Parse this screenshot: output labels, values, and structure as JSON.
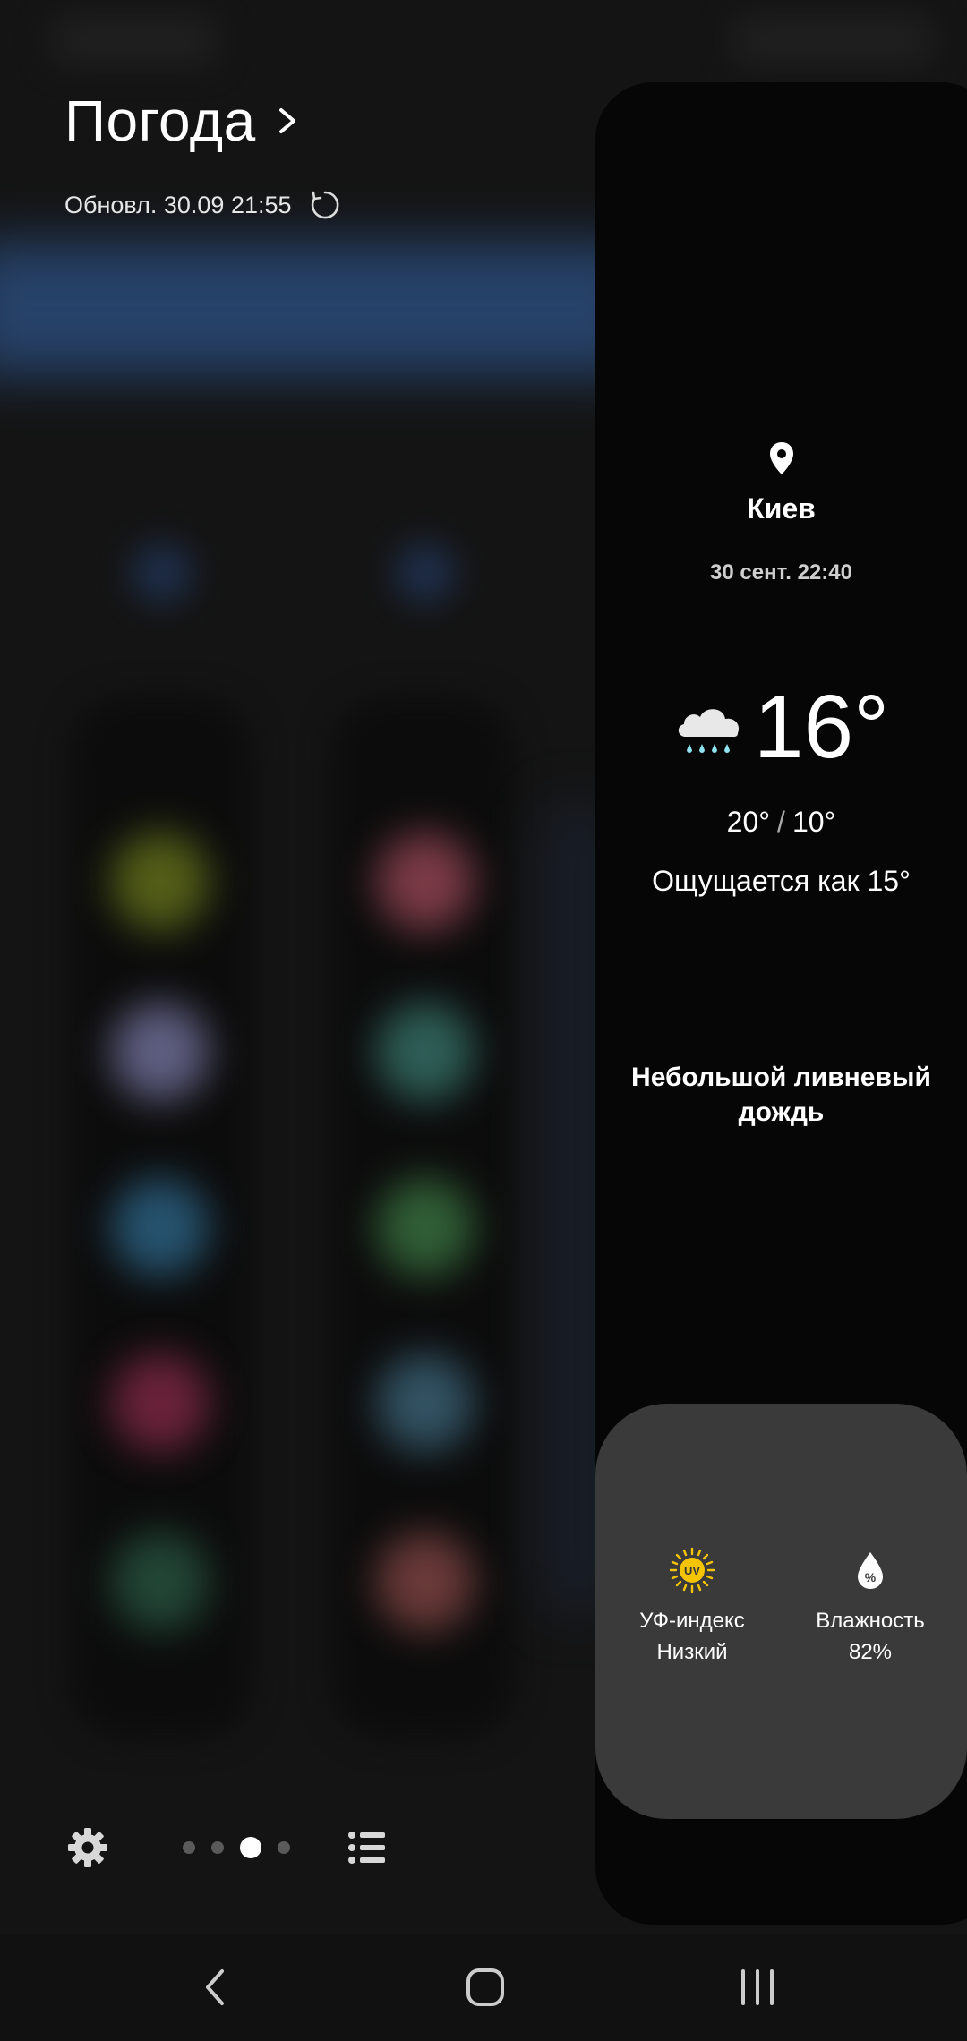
{
  "header": {
    "title": "Погода",
    "updated": "Обновл. 30.09 21:55"
  },
  "weather": {
    "city": "Киев",
    "datetime": "30 сент. 22:40",
    "temperature": "16°",
    "high": "20°",
    "separator": "/",
    "low": "10°",
    "feels_like": "Ощущается как 15°",
    "condition": "Небольшой ливневый дождь",
    "condition_icon": "rain-cloud-icon"
  },
  "details": {
    "uv": {
      "label": "УФ-индекс",
      "value": "Низкий",
      "icon": "uv-index-icon",
      "icon_text": "UV"
    },
    "humidity": {
      "label": "Влажность",
      "value": "82%",
      "icon": "humidity-drop-icon",
      "icon_text": "%"
    }
  },
  "pager": {
    "count": 4,
    "active_index": 2
  },
  "colors": {
    "panel_bg": "#060606",
    "card_bg": "#3a3a3a",
    "uv_yellow": "#f5c400",
    "rain_drop": "#8fe3f0"
  }
}
